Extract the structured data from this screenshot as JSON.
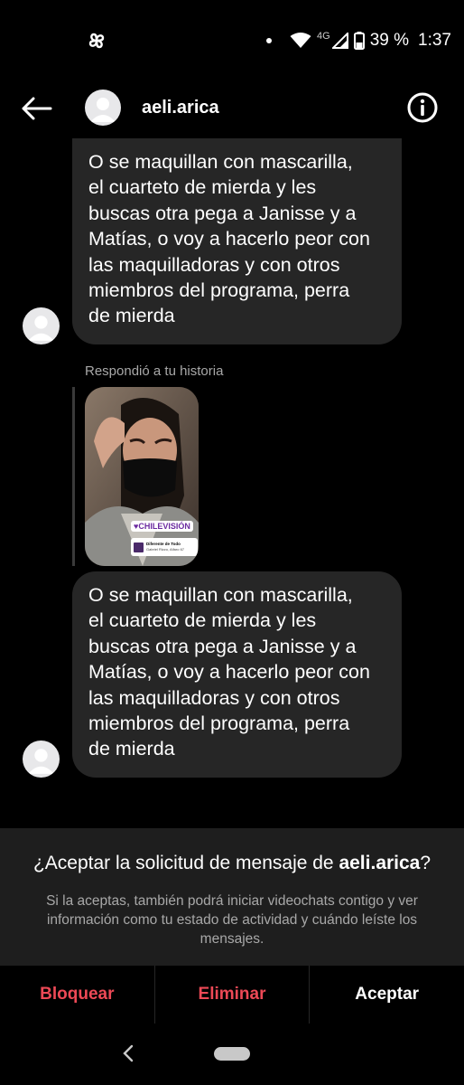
{
  "status_bar": {
    "network": "4G",
    "battery": "39 %",
    "time": "1:37"
  },
  "header": {
    "username": "aeli.arica"
  },
  "messages": [
    {
      "text": "O se maquillan con mascarilla,\nel cuarteto de mierda y les\nbuscas otra pega a Janisse y a\nMatías, o voy a hacerlo peor con\nlas maquilladoras y con otros\nmiembros del programa, perra\nde mierda"
    },
    {
      "text": "O se maquillan con mascarilla,\nel cuarteto de mierda y les\nbuscas otra pega a Janisse y a\nMatías, o voy a hacerlo peor con\nlas maquilladoras y con otros\nmiembros del programa, perra\nde mierda"
    }
  ],
  "story_reply": {
    "label": "Respondió a tu historia",
    "tag": "♥CHILEVISIÓN",
    "location_title": "Diferente de Todo",
    "location_sub": "Gabriel Rizzo, Alfaro 67"
  },
  "request": {
    "title_prefix": "¿Aceptar la solicitud de mensaje de ",
    "title_user": "aeli.arica",
    "title_suffix": "?",
    "description": "Si la aceptas, también podrá iniciar videochats contigo y ver información como tu estado de actividad y cuándo leíste los mensajes."
  },
  "actions": {
    "block": "Bloquear",
    "delete": "Eliminar",
    "accept": "Aceptar"
  },
  "colors": {
    "danger": "#ed4956",
    "bubble": "#262626",
    "panel": "#1e1e1e"
  }
}
